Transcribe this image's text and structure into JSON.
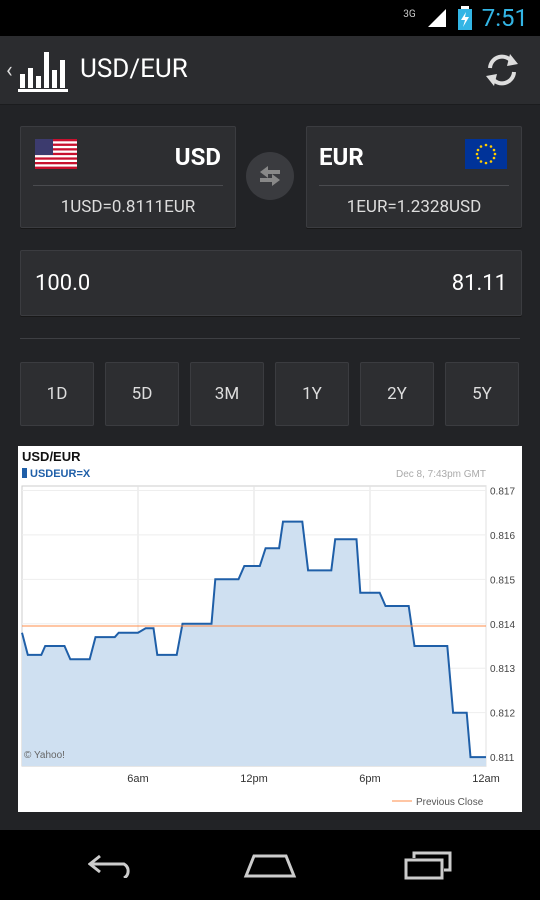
{
  "status": {
    "network": "3G",
    "time": "7:51"
  },
  "appbar": {
    "title": "USD/EUR"
  },
  "from": {
    "code": "USD",
    "rate": "1USD=0.8111EUR"
  },
  "to": {
    "code": "EUR",
    "rate": "1EUR=1.2328USD"
  },
  "amount": {
    "input": "100.0",
    "result": "81.11"
  },
  "ranges": [
    "1D",
    "5D",
    "3M",
    "1Y",
    "2Y",
    "5Y"
  ],
  "chart_data": {
    "type": "line",
    "title": "USD/EUR",
    "series": [
      {
        "name": "USDEUR=X",
        "values": [
          0.8138,
          0.8133,
          0.8133,
          0.8135,
          0.8135,
          0.8132,
          0.8132,
          0.8137,
          0.8137,
          0.8138,
          0.8138,
          0.8139,
          0.8139,
          0.8133,
          0.8133,
          0.814,
          0.814,
          0.815,
          0.815,
          0.8153,
          0.8153,
          0.8157,
          0.8157,
          0.8163,
          0.8163,
          0.8152,
          0.8152,
          0.8159,
          0.8159,
          0.8147,
          0.8147,
          0.8144,
          0.8144,
          0.8135,
          0.8135,
          0.812,
          0.812,
          0.811,
          0.811
        ]
      }
    ],
    "x": [
      0,
      0.3,
      1.0,
      1.2,
      2.2,
      2.5,
      3.5,
      3.8,
      4.8,
      5.0,
      6.0,
      6.4,
      6.8,
      7.0,
      8.0,
      8.3,
      9.8,
      10.0,
      11.2,
      11.5,
      12.3,
      12.6,
      13.3,
      13.5,
      14.5,
      14.8,
      16.0,
      16.2,
      17.3,
      17.5,
      18.5,
      18.8,
      20.0,
      20.3,
      22.0,
      22.3,
      23.0,
      23.2,
      24.0
    ],
    "xticks": [
      "6am",
      "12pm",
      "6pm",
      "12am"
    ],
    "ylim": [
      0.8108,
      0.8171
    ],
    "yticks": [
      "0.817",
      "0.816",
      "0.815",
      "0.814",
      "0.813",
      "0.812",
      "0.811"
    ],
    "previous_close": 0.81395,
    "timestamp": "Dec 8, 7:43pm GMT",
    "credit": "© Yahoo!",
    "legend": "Previous Close"
  }
}
